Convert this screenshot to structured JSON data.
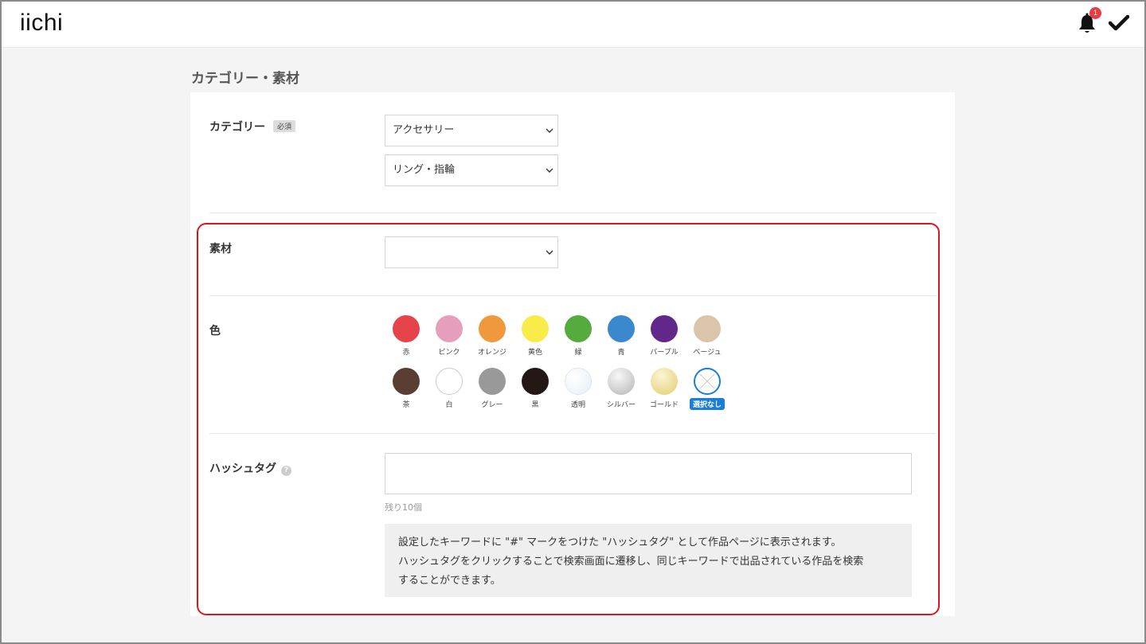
{
  "header": {
    "logo": "iichi",
    "notification_count": "1"
  },
  "section": {
    "title": "カテゴリー・素材"
  },
  "category": {
    "label": "カテゴリー",
    "required_badge": "必須",
    "select1_value": "アクセサリー",
    "select2_value": "リング・指輪"
  },
  "material": {
    "label": "素材",
    "select_value": ""
  },
  "color": {
    "label": "色",
    "options": [
      {
        "label": "赤",
        "color": "#e6444b"
      },
      {
        "label": "ピンク",
        "color": "#e59fbd"
      },
      {
        "label": "オレンジ",
        "color": "#f0983c"
      },
      {
        "label": "黄色",
        "color": "#faec48"
      },
      {
        "label": "緑",
        "color": "#55ab3e"
      },
      {
        "label": "青",
        "color": "#3a89cf"
      },
      {
        "label": "パープル",
        "color": "#61278a"
      },
      {
        "label": "ベージュ",
        "color": "#dcc4ab"
      },
      {
        "label": "茶",
        "color": "#5a3d33"
      },
      {
        "label": "白",
        "color": "#ffffff"
      },
      {
        "label": "グレー",
        "color": "#999999"
      },
      {
        "label": "黒",
        "color": "#231816"
      },
      {
        "label": "透明",
        "color": "#eef4fa"
      },
      {
        "label": "シルバー",
        "color": "#c8c8c8"
      },
      {
        "label": "ゴールド",
        "color": "#eedd8e"
      },
      {
        "label": "選択なし",
        "color": "#ffffff"
      }
    ]
  },
  "hashtag": {
    "label": "ハッシュタグ",
    "help": "?",
    "remaining": "残り10個",
    "info_line1": "設定したキーワードに \"#\" マークをつけた \"ハッシュタグ\" として作品ページに表示されます。",
    "info_line2": "ハッシュタグをクリックすることで検索画面に遷移し、同じキーワードで出品されている作品を検索",
    "info_line3": "することができます。"
  }
}
